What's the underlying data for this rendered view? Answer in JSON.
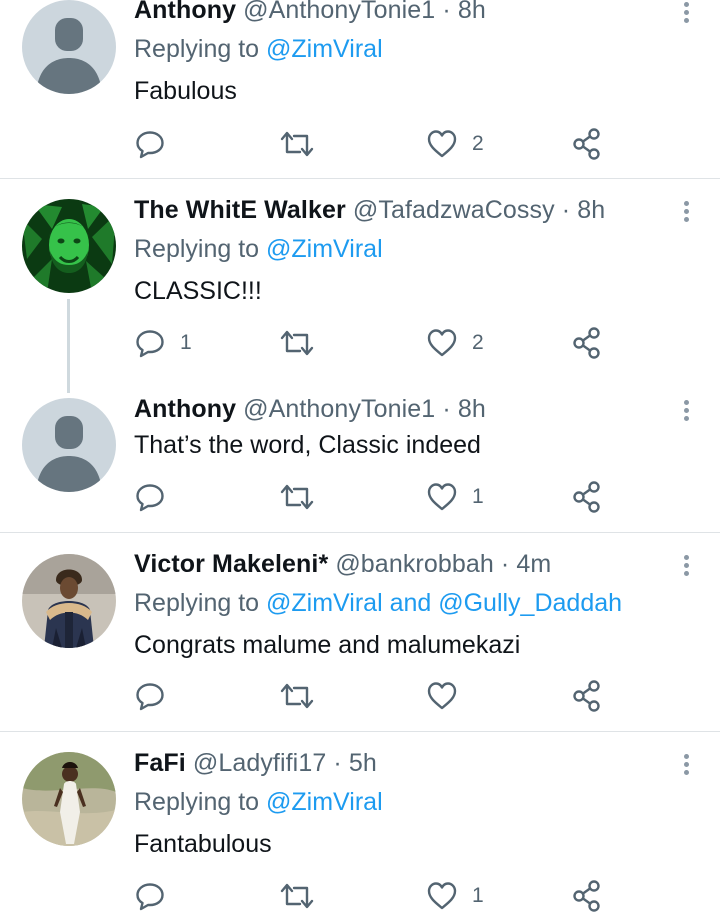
{
  "tweets": [
    {
      "name": "Anthony",
      "handle": "@AnthonyTonie1",
      "time": "8h",
      "sep": "·",
      "replying_prefix": "Replying to",
      "replying_to": "@ZimViral",
      "text": "Fabulous",
      "reply_count": "",
      "like_count": "2",
      "avatar": "default-avatar"
    },
    {
      "name": "The WhitE Walker",
      "handle": "@TafadzwaCossy",
      "time": "8h",
      "sep": "·",
      "replying_prefix": "Replying to",
      "replying_to": "@ZimViral",
      "text": "CLASSIC!!!",
      "reply_count": "1",
      "like_count": "2",
      "avatar": "green-portrait-avatar"
    },
    {
      "name": "Anthony",
      "handle": "@AnthonyTonie1",
      "time": "8h",
      "sep": "·",
      "text": "That’s the word, Classic indeed",
      "reply_count": "",
      "like_count": "1",
      "avatar": "default-avatar"
    },
    {
      "name": "Victor Makeleni*",
      "handle": "@bankrobbah",
      "time": "4m",
      "sep": "·",
      "replying_prefix": "Replying to",
      "replying_to": "@ZimViral and @Gully_Daddah",
      "text": "Congrats malume and malumekazi",
      "reply_count": "",
      "like_count": "",
      "avatar": "photo-avatar-jacket"
    },
    {
      "name": "FaFi",
      "handle": "@Ladyfifi17",
      "time": "5h",
      "sep": "·",
      "replying_prefix": "Replying to",
      "replying_to": "@ZimViral",
      "text": "Fantabulous",
      "reply_count": "",
      "like_count": "1",
      "avatar": "photo-avatar-white-dress"
    }
  ],
  "icons": {
    "reply": "reply-icon",
    "retweet": "retweet-icon",
    "like": "like-icon",
    "share": "share-icon",
    "more": "more-options-icon"
  },
  "colors": {
    "link": "#1d9bf0",
    "muted": "#536471",
    "divider": "#dfe3e6"
  }
}
